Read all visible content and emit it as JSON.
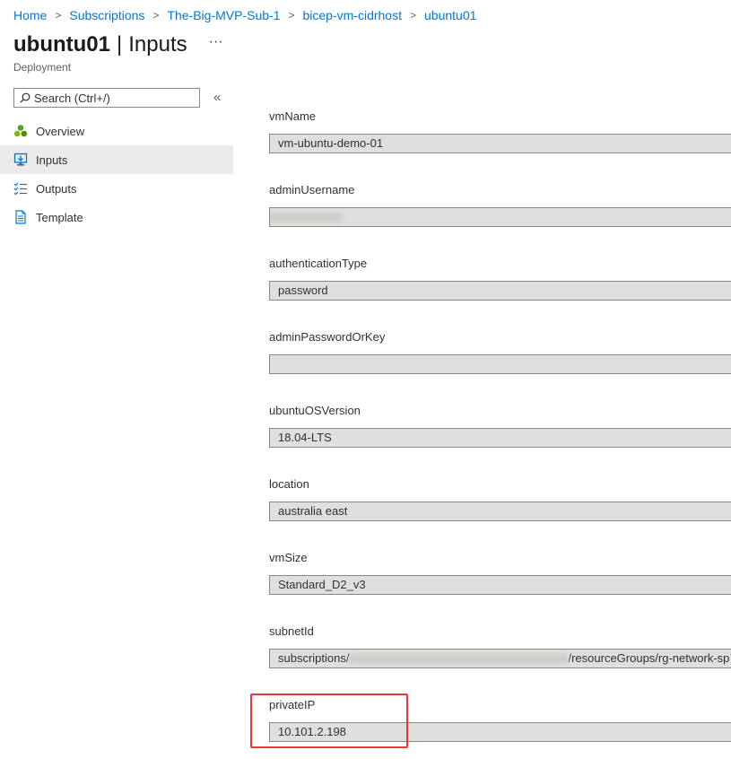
{
  "breadcrumb": [
    "Home",
    "Subscriptions",
    "The-Big-MVP-Sub-1",
    "bicep-vm-cidrhost",
    "ubuntu01"
  ],
  "header": {
    "title": "ubuntu01",
    "separator": "|",
    "section": "Inputs",
    "more": "···",
    "subtitle": "Deployment"
  },
  "search": {
    "placeholder": "Search (Ctrl+/)"
  },
  "collapse": "«",
  "nav": [
    {
      "label": "Overview",
      "icon": "overview-icon"
    },
    {
      "label": "Inputs",
      "icon": "inputs-icon",
      "active": true
    },
    {
      "label": "Outputs",
      "icon": "outputs-icon"
    },
    {
      "label": "Template",
      "icon": "template-icon"
    }
  ],
  "fields": [
    {
      "label": "vmName",
      "value": "vm-ubuntu-demo-01"
    },
    {
      "label": "adminUsername",
      "value": ""
    },
    {
      "label": "authenticationType",
      "value": "password"
    },
    {
      "label": "adminPasswordOrKey",
      "value": ""
    },
    {
      "label": "ubuntuOSVersion",
      "value": "18.04-LTS"
    },
    {
      "label": "location",
      "value": "australia east"
    },
    {
      "label": "vmSize",
      "value": "Standard_D2_v3"
    },
    {
      "label": "subnetId",
      "value_prefix": "subscriptions/",
      "value_suffix": "/resourceGroups/rg-network-sp"
    },
    {
      "label": "privateIP",
      "value": "10.101.2.198"
    }
  ],
  "colors": {
    "link": "#0078d4",
    "highlight": "#e8383c",
    "field_bg": "#e1dfdd",
    "nav_active": "#edebe9"
  }
}
